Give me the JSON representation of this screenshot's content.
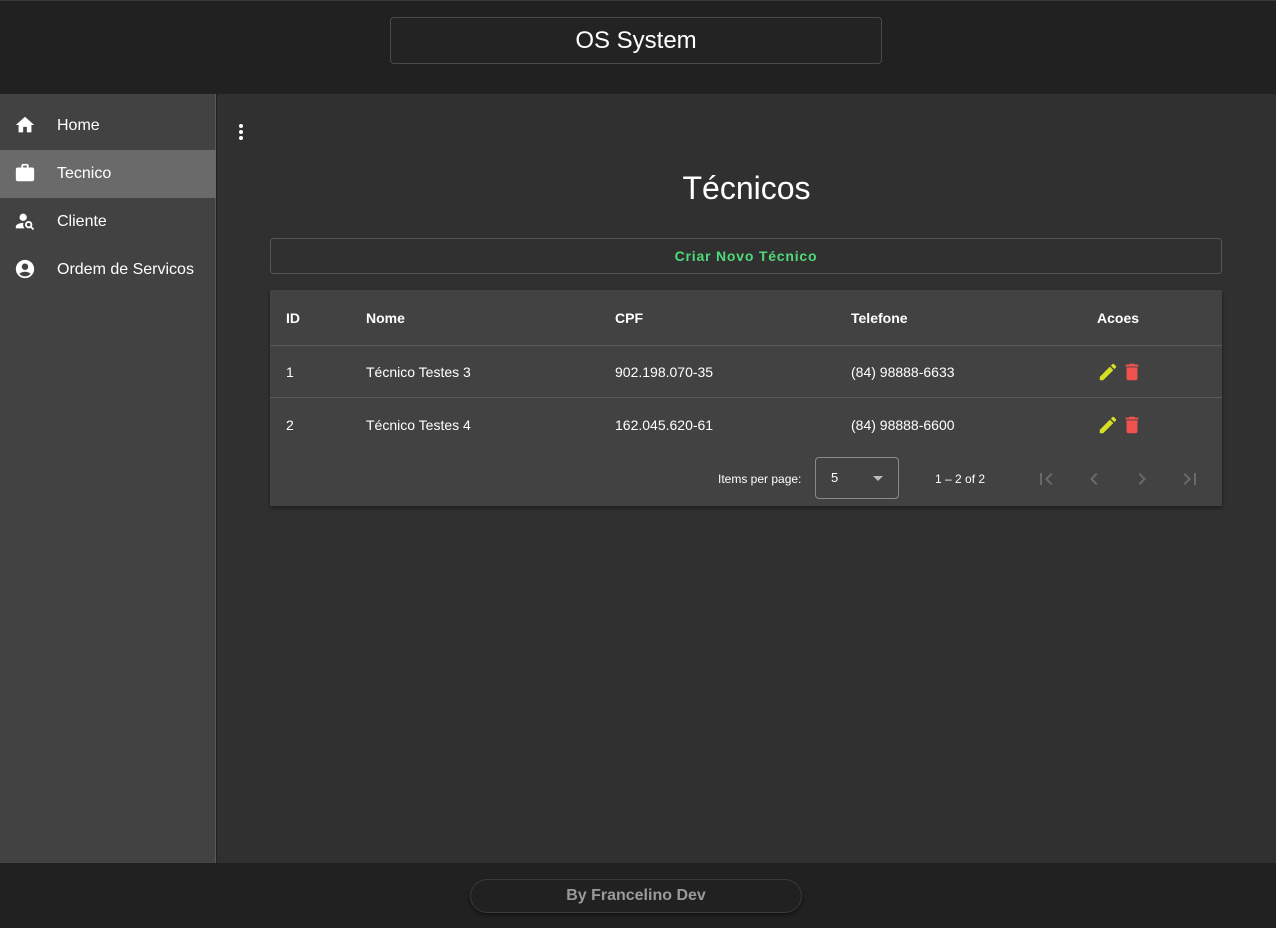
{
  "app": {
    "title": "OS System"
  },
  "sidebar": {
    "items": [
      {
        "label": "Home",
        "icon": "home-icon"
      },
      {
        "label": "Tecnico",
        "icon": "briefcase-icon",
        "active": true
      },
      {
        "label": "Cliente",
        "icon": "person-search-icon"
      },
      {
        "label": "Ordem de Servicos",
        "icon": "account-circle-icon"
      }
    ]
  },
  "main": {
    "page_title": "Técnicos",
    "new_button_label": "Criar Novo Técnico",
    "table": {
      "columns": [
        "ID",
        "Nome",
        "CPF",
        "Telefone",
        "Acoes"
      ],
      "rows": [
        {
          "id": "1",
          "nome": "Técnico Testes 3",
          "cpf": "902.198.070-35",
          "telefone": "(84) 98888-6633"
        },
        {
          "id": "2",
          "nome": "Técnico Testes 4",
          "cpf": "162.045.620-61",
          "telefone": "(84) 98888-6600"
        }
      ]
    },
    "paginator": {
      "items_per_page_label": "Items per page:",
      "page_size": "5",
      "range_label": "1 – 2 of 2"
    }
  },
  "footer": {
    "credit": "By Francelino Dev"
  },
  "colors": {
    "accent_green": "#4fd97a",
    "edit_yellow": "#d4e021",
    "delete_red": "#ef5350"
  }
}
